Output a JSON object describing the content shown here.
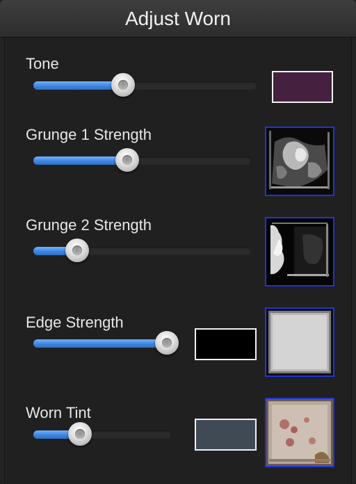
{
  "panel": {
    "title": "Adjust Worn"
  },
  "controls": {
    "tone": {
      "label": "Tone",
      "slider_value": 0.4,
      "color": "#45213f"
    },
    "grunge1": {
      "label": "Grunge 1 Strength",
      "slider_value": 0.43,
      "texture_icon": "grunge-texture-1-icon"
    },
    "grunge2": {
      "label": "Grunge 2 Strength",
      "slider_value": 0.2,
      "texture_icon": "grunge-texture-2-icon"
    },
    "edge": {
      "label": "Edge Strength",
      "slider_value": 0.92,
      "color": "#000000",
      "texture_icon": "edge-texture-icon"
    },
    "worn_tint": {
      "label": "Worn Tint",
      "slider_value": 0.34,
      "color": "#3f4a54",
      "texture_icon": "worn-tint-texture-icon"
    }
  },
  "colors": {
    "accent": "#3f86e0",
    "texture_border": "#2233d6"
  }
}
